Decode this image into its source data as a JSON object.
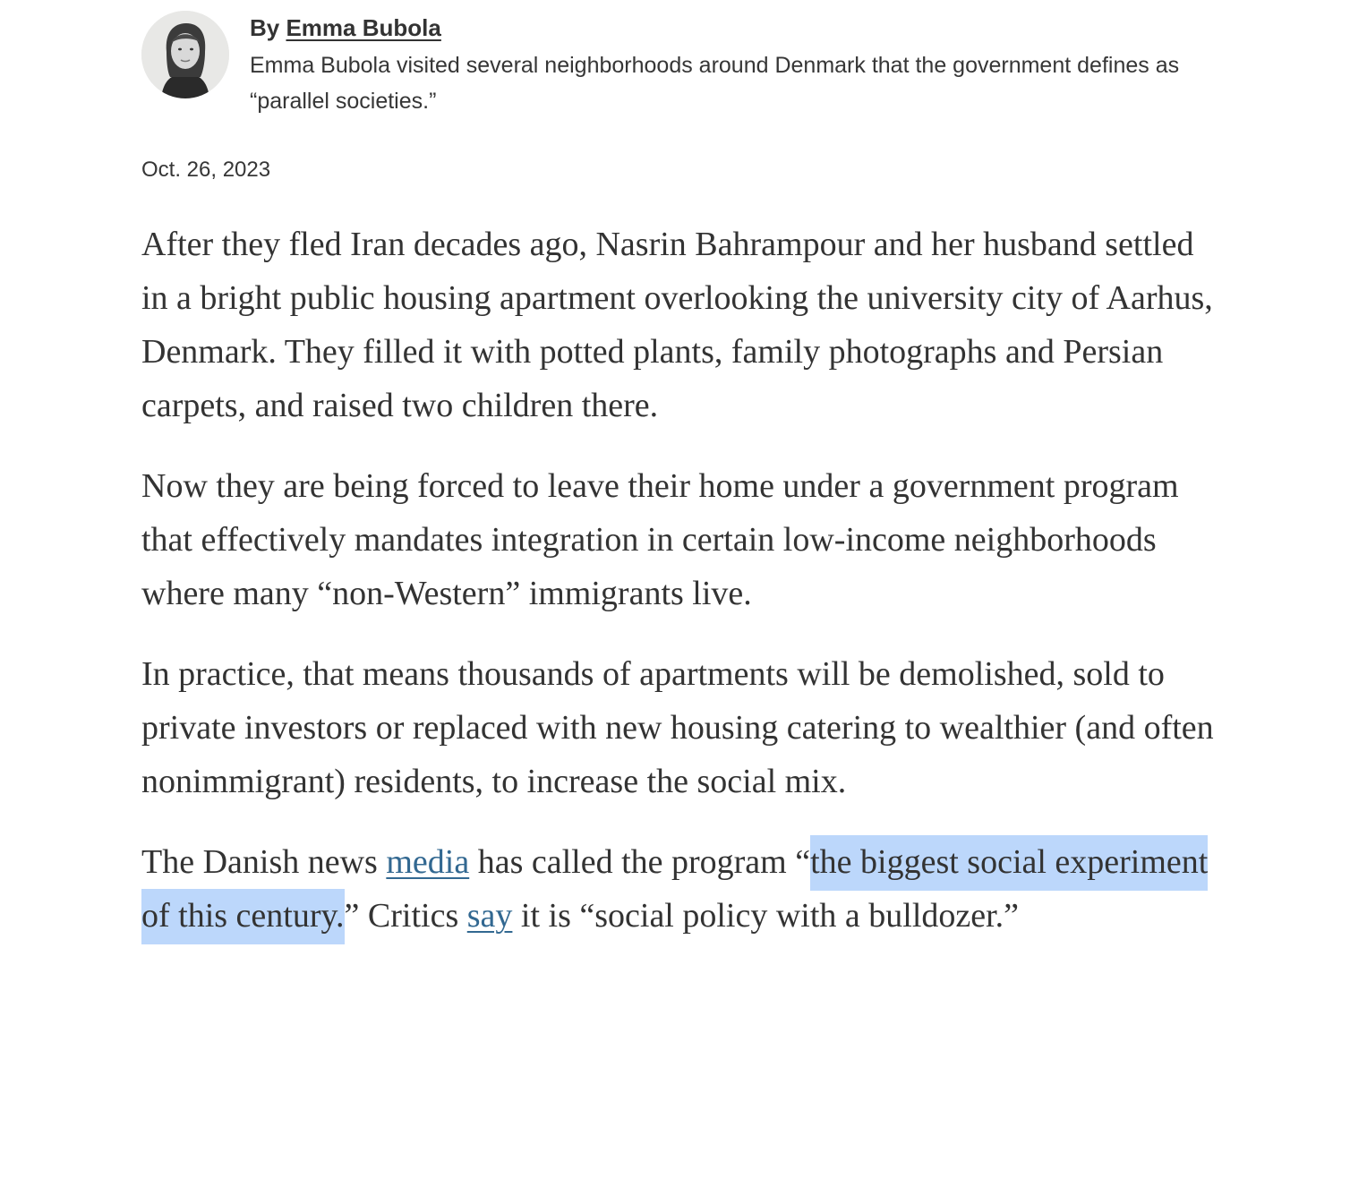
{
  "byline": {
    "prefix": "By ",
    "author": "Emma Bubola",
    "description": "Emma Bubola visited several neighborhoods around Denmark that the government defines as “parallel societies.”"
  },
  "date": "Oct. 26, 2023",
  "paragraphs": {
    "p1": "After they fled Iran decades ago, Nasrin Bahrampour and her husband settled in a bright public housing apartment overlooking the university city of Aarhus, Denmark. They filled it with potted plants, family photographs and Persian carpets, and raised two children there.",
    "p2": "Now they are being forced to leave their home under a government program that effectively mandates integration in certain low-income neighborhoods where many “non-Western” immigrants live.",
    "p3": "In practice, that means thousands of apartments will be demolished, sold to private investors or replaced with new housing catering to wealthier (and often nonimmigrant) residents, to increase the social mix.",
    "p4": {
      "t1": "The Danish news ",
      "link1": "media",
      "t2": " has called the program “",
      "highlight": "the biggest social experiment of this century.",
      "t3": "” Critics ",
      "link2": "say",
      "t4": " it is “social policy with a bulldozer.”"
    }
  },
  "colors": {
    "text": "#333333",
    "link": "#326891",
    "selection_highlight": "#bcd7fb"
  }
}
